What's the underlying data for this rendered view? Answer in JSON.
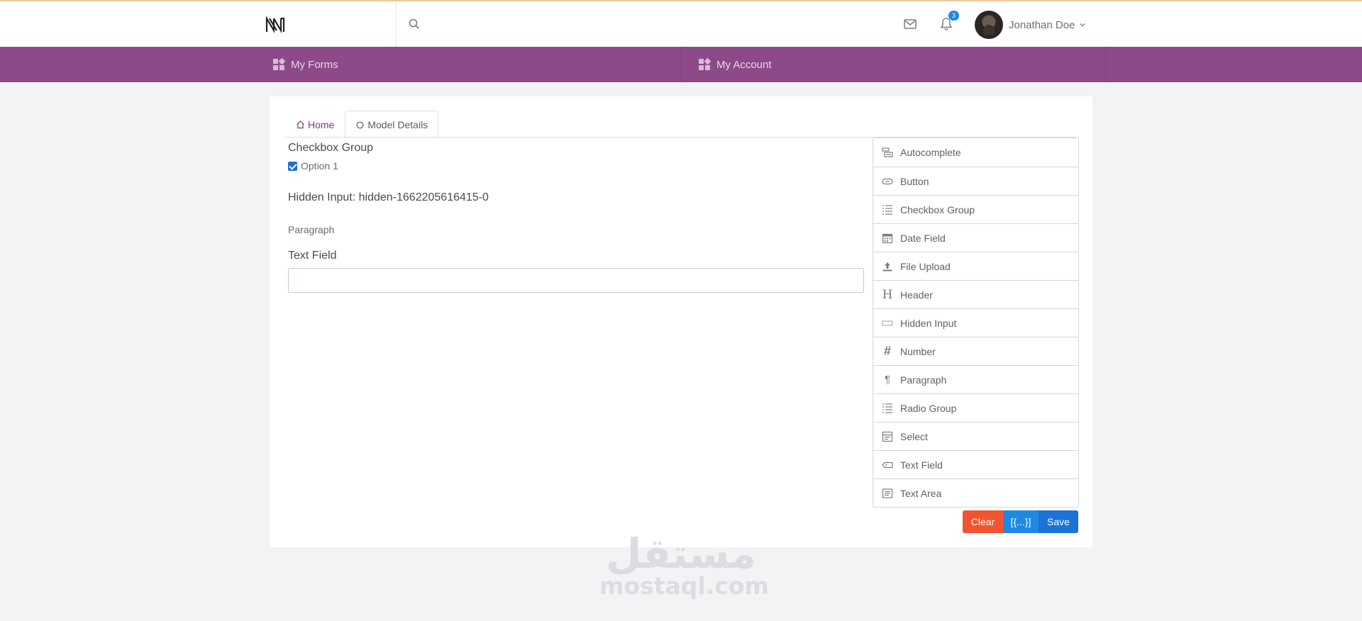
{
  "header": {
    "notification_count": "3",
    "user_name": "Jonathan Doe"
  },
  "nav": {
    "items": [
      {
        "label": "My Forms",
        "icon": "dashboard-icon"
      },
      {
        "label": "My Account",
        "icon": "dashboard-icon"
      }
    ]
  },
  "tabs": [
    {
      "label": "Home",
      "icon": "home-icon"
    },
    {
      "label": "Model Details",
      "icon": "circle-icon",
      "active": true
    }
  ],
  "form": {
    "checkbox_group": {
      "label": "Checkbox Group",
      "options": [
        {
          "label": "Option 1",
          "checked": true
        }
      ]
    },
    "hidden_input_text": "Hidden Input: hidden-1662205616415-0",
    "paragraph_text": "Paragraph",
    "text_field": {
      "label": "Text Field",
      "value": ""
    }
  },
  "controls": [
    {
      "label": "Autocomplete",
      "icon": "autocomplete-icon"
    },
    {
      "label": "Button",
      "icon": "button-icon"
    },
    {
      "label": "Checkbox Group",
      "icon": "checkbox-list-icon"
    },
    {
      "label": "Date Field",
      "icon": "calendar-icon"
    },
    {
      "label": "File Upload",
      "icon": "upload-icon"
    },
    {
      "label": "Header",
      "icon": "header-icon"
    },
    {
      "label": "Hidden Input",
      "icon": "hidden-input-icon"
    },
    {
      "label": "Number",
      "icon": "hash-icon"
    },
    {
      "label": "Paragraph",
      "icon": "pilcrow-icon"
    },
    {
      "label": "Radio Group",
      "icon": "radio-list-icon"
    },
    {
      "label": "Select",
      "icon": "select-icon"
    },
    {
      "label": "Text Field",
      "icon": "text-field-icon"
    },
    {
      "label": "Text Area",
      "icon": "text-area-icon"
    }
  ],
  "actions": {
    "clear_label": "Clear",
    "json_label": "[{...}]",
    "save_label": "Save"
  },
  "watermark": {
    "arabic": "مستقل",
    "latin": "mostaql.com"
  },
  "colors": {
    "nav_bg": "#8c4a8a",
    "accent_blue": "#1e88e5",
    "clear_red": "#f5532f"
  }
}
